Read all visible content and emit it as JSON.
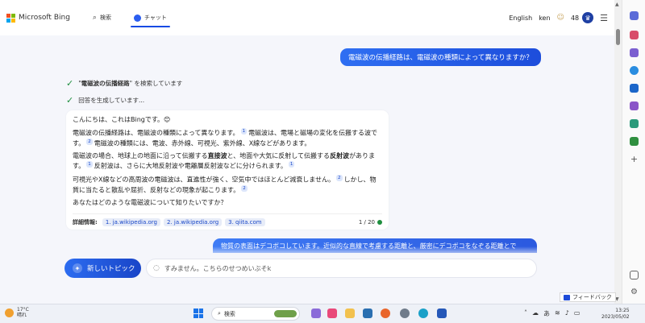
{
  "header": {
    "brand": "Microsoft Bing",
    "tabs": [
      {
        "label": "検索",
        "icon": "search-icon"
      },
      {
        "label": "チャット",
        "icon": "chat-icon",
        "active": true
      }
    ],
    "language": "English",
    "user": "ken",
    "rewards_points": "48"
  },
  "chat": {
    "user_question": "電磁波の伝播経路は、電磁波の種類によって異なりますか？",
    "status": [
      {
        "pre": "\"",
        "bold": "電磁波の伝播経路",
        "post": "\" を検索しています"
      },
      {
        "text": "回答を生成しています..."
      }
    ],
    "answer": {
      "greeting": "こんにちは、これはBingです。😊",
      "p1a": "電磁波の伝播経路は、電磁波の種類によって異なります。",
      "p1b": "電磁波は、電場と磁場の変化を伝搬する波です。",
      "p1c": "電磁波の種類には、電波、赤外線、可視光、紫外線、X線などがあります。",
      "p2a": "電磁波の場合、地球上の地面に沿って伝搬する",
      "p2b": "直接波",
      "p2c": "と、地面や大気に反射して伝搬する",
      "p2d": "反射波",
      "p2e": "があります。",
      "p2f": "反射波は、さらに大地反射波や電離層反射波などに分けられます。",
      "p3a": "可視光やX線などの高周波の電磁波は、直進性が強く、空気中ではほとんど減衰しません。",
      "p3b": "しかし、物質に当たると散乱や屈折、反射などの現象が起こります。",
      "question": "あなたはどのような電磁波について知りたいですか？",
      "cites": [
        "1",
        "2",
        "1",
        "2",
        "1"
      ],
      "more_label": "詳細情報:",
      "sources": [
        "1. ja.wikipedia.org",
        "2. ja.wikipedia.org",
        "3. qiita.com"
      ],
      "counter": "1 / 20"
    },
    "next_user_message": "物質の表面はデコボコしています。近似的な直線で考慮する距離と、厳密にデコボコをなぞる距離とで"
  },
  "composer": {
    "new_topic": "新しいトピック",
    "placeholder": "すみません。こちらのせつめいぶそk"
  },
  "feedback": "フィードバック",
  "taskbar": {
    "temperature": "17°C",
    "weather": "晴れ",
    "search": "検索",
    "time": "13:25",
    "date": "2023/05/02",
    "ime": "あ"
  },
  "colors": {
    "accent": "#1d4ddb",
    "check": "#1e8e3e"
  }
}
